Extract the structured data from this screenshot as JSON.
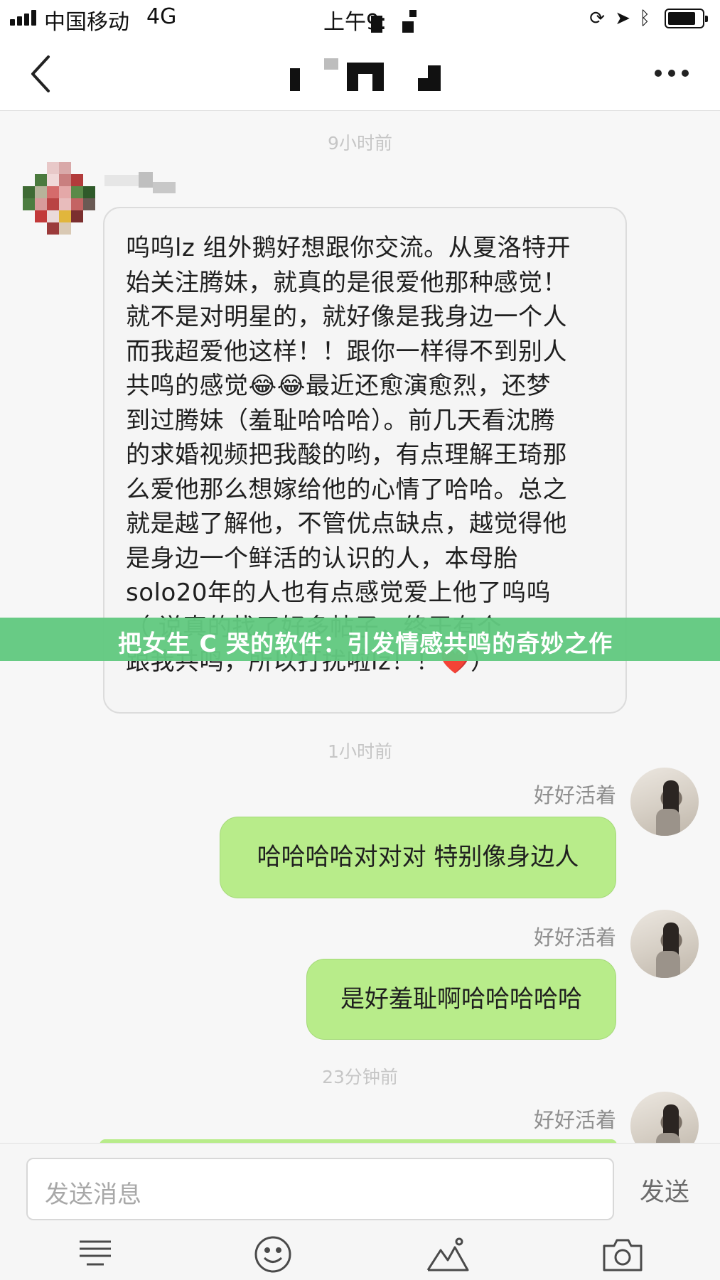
{
  "status_bar": {
    "carrier": "中国移动",
    "network": "4G",
    "time": "上午9:"
  },
  "nav": {
    "back_icon": "chevron-left-icon",
    "more_icon": "more-horizontal-icon"
  },
  "chat": {
    "messages": [
      {
        "timestamp": "9小时前",
        "direction": "incoming",
        "lines": [
          "呜呜lz 组外鹅好想跟你交流。从夏洛特开",
          "始关注腾妹，就真的是很爱他那种感觉！",
          "就不是对明星的，就好像是我身边一个人",
          "而我超爱他这样！！跟你一样得不到别人",
          "共鸣的感觉😂😂最近还愈演愈烈，还梦",
          "到过腾妹（羞耻哈哈哈）。前几天看沈腾",
          "的求婚视频把我酸的哟，有点理解王琦那",
          "么爱他那么想嫁给他的心情了哈哈。总之",
          "就是越了解他，不管优点缺点，越觉得他",
          "是身边一个鲜活的认识的人，本母胎",
          "solo20年的人也有点感觉爱上他了呜呜",
          "（ 说真的找了好多帖子，终于有个 ",
          "跟我共鸣，所以打扰啦lz！！❤️）"
        ]
      },
      {
        "timestamp": "1小时前",
        "direction": "outgoing",
        "sender": "好好活着",
        "text": "哈哈哈哈对对对 特别像身边人"
      },
      {
        "direction": "outgoing",
        "sender": "好好活着",
        "text": "是好羞耻啊哈哈哈哈哈"
      },
      {
        "timestamp": "23分钟前",
        "direction": "outgoing",
        "sender": "好好活着",
        "text": ""
      }
    ]
  },
  "banner": {
    "text": "把女生 C 哭的软件：引发情感共鸣的奇妙之作"
  },
  "composer": {
    "placeholder": "发送消息",
    "send_label": "发送",
    "tools": [
      "list-icon",
      "emoji-icon",
      "image-icon",
      "camera-icon"
    ]
  },
  "colors": {
    "outgoing_bubble": "#b8ec8a",
    "incoming_bubble": "#f5f5f5",
    "banner": "#62c980"
  }
}
